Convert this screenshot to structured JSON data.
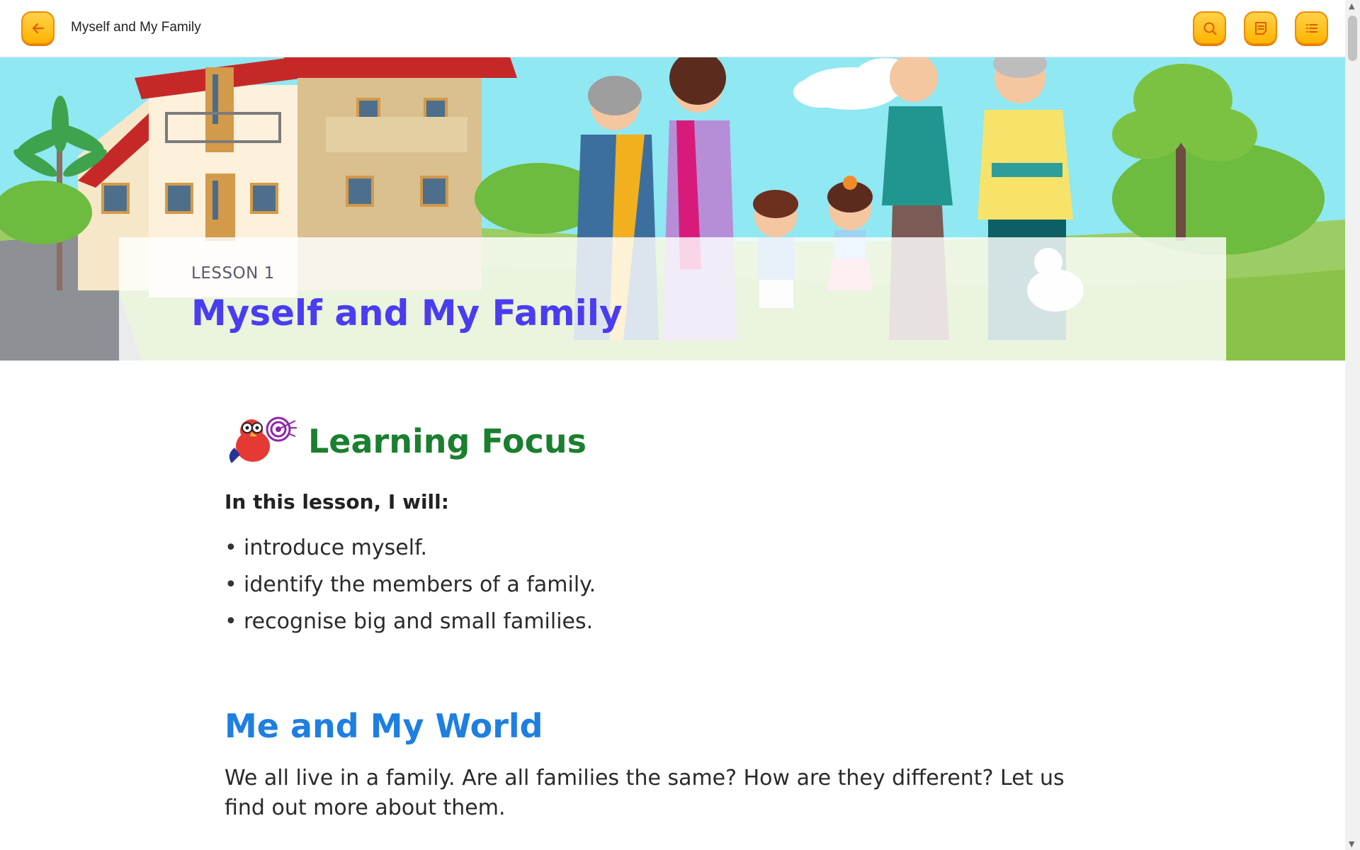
{
  "header": {
    "title": "Myself and My Family",
    "back_icon": "arrow-left-icon",
    "search_icon": "search-icon",
    "notes_icon": "notes-icon",
    "toc_icon": "list-icon"
  },
  "hero": {
    "lesson_label": "LESSON 1",
    "lesson_title": "Myself and My Family"
  },
  "learning_focus": {
    "heading": "Learning Focus",
    "mascot_icon": "bird-target-icon",
    "intro": "In this lesson, I will:",
    "items": [
      "introduce myself.",
      "identify the members of a family.",
      "recognise big and small families."
    ]
  },
  "section": {
    "heading": "Me and My World",
    "paragraph": "We all live in a family. Are all families the same? How are they different? Let us find out more about them."
  },
  "colors": {
    "button": "#ffc21f",
    "lesson_title": "#4a3cf0",
    "focus_title": "#1a7f2e",
    "section_title": "#1e7fe0"
  }
}
